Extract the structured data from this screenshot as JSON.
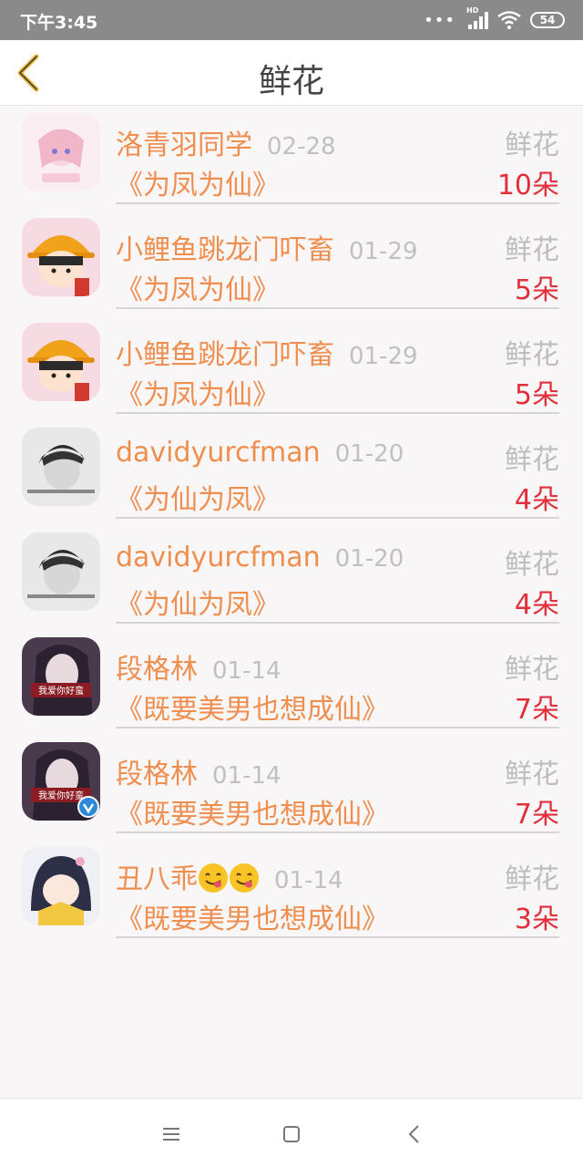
{
  "status_bar": {
    "time": "下午3:45",
    "network_badge": "HD",
    "battery": "54"
  },
  "header": {
    "title": "鲜花"
  },
  "rows": [
    {
      "name": "洛青羽同学",
      "date": "02-28",
      "book": "《为凤为仙》",
      "label": "鲜花",
      "count": "10朵"
    },
    {
      "name": "小鲤鱼跳龙门吓畜",
      "date": "01-29",
      "book": "《为凤为仙》",
      "label": "鲜花",
      "count": "5朵"
    },
    {
      "name": "小鲤鱼跳龙门吓畜",
      "date": "01-29",
      "book": "《为凤为仙》",
      "label": "鲜花",
      "count": "5朵"
    },
    {
      "name": "davidyurcfman",
      "date": "01-20",
      "book": "《为仙为凤》",
      "label": "鲜花",
      "count": "4朵"
    },
    {
      "name": "davidyurcfman",
      "date": "01-20",
      "book": "《为仙为凤》",
      "label": "鲜花",
      "count": "4朵"
    },
    {
      "name": "段格林",
      "date": "01-14",
      "book": "《既要美男也想成仙》",
      "label": "鲜花",
      "count": "7朵"
    },
    {
      "name": "段格林",
      "date": "01-14",
      "book": "《既要美男也想成仙》",
      "label": "鲜花",
      "count": "7朵"
    },
    {
      "name": "丑八乖",
      "date": "01-14",
      "book": "《既要美男也想成仙》",
      "label": "鲜花",
      "count": "3朵"
    }
  ],
  "avatars": [
    {
      "icon": "anime-girl-pink-avatar",
      "caption": ""
    },
    {
      "icon": "maruko-cartoon-avatar",
      "caption": ""
    },
    {
      "icon": "maruko-cartoon-avatar",
      "caption": ""
    },
    {
      "icon": "boy-photo-avatar",
      "caption": ""
    },
    {
      "icon": "boy-photo-avatar",
      "caption": ""
    },
    {
      "icon": "girl-photo-avatar",
      "caption": "我爱你好蛮"
    },
    {
      "icon": "girl-photo-avatar",
      "caption": "我爱你好蛮"
    },
    {
      "icon": "anime-girl-verified-avatar",
      "caption": ""
    }
  ],
  "colors": {
    "accent": "#ef8f4f",
    "count_red": "#e0303b",
    "muted": "#bdbdbd",
    "back_arrow": "#e5b336"
  }
}
